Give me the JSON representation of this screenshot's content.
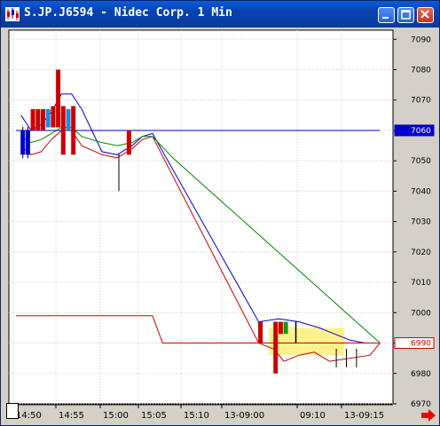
{
  "window": {
    "title": "S.JP.J6594 - Nidec Corp. 1 Min",
    "icon": "candlestick-app-icon",
    "buttons": [
      "minimize-icon",
      "maximize-icon",
      "close-icon"
    ]
  },
  "chart_data": {
    "type": "line",
    "ylim": [
      6970,
      7093
    ],
    "y_ticks": [
      "7090",
      "7080",
      "7070",
      "7060",
      "7050",
      "7040",
      "7030",
      "7020",
      "7010",
      "7000",
      "6990",
      "6980",
      "6970"
    ],
    "x_tick_labels": [
      "14:50",
      "14:55",
      "15:00",
      "15:05",
      "15:10",
      "13-09:00",
      "09:10",
      "13-09:15"
    ],
    "grid": true,
    "price_markers": [
      {
        "value": 7060,
        "label": "7060",
        "color": "#0000cc"
      },
      {
        "value": 6990,
        "label": "6990",
        "color": "#cc0000"
      }
    ],
    "bars": [
      {
        "slot": 1,
        "open": 7060,
        "close": 7052,
        "color": "#0000cc",
        "wick": true
      },
      {
        "slot": 2,
        "open": 7060,
        "close": 7052,
        "color": "#0000cc",
        "wick": true
      },
      {
        "slot": 3,
        "open": 7067,
        "close": 7060,
        "color": "#cc0000"
      },
      {
        "slot": 4,
        "open": 7067,
        "close": 7060,
        "color": "#cc0000"
      },
      {
        "slot": 5,
        "open": 7067,
        "close": 7060,
        "color": "#cc0000"
      },
      {
        "slot": 6,
        "open": 7061,
        "close": 7067,
        "color": "#2288dd"
      },
      {
        "slot": 7,
        "open": 7061,
        "close": 7068,
        "color": "#cc0000"
      },
      {
        "slot": 8,
        "open": 7080,
        "close": 7061,
        "color": "#cc0000"
      },
      {
        "slot": 9,
        "open": 7068,
        "close": 7052,
        "color": "#cc0000"
      },
      {
        "slot": 10,
        "open": 7067,
        "close": 7060,
        "color": "#2288dd"
      },
      {
        "slot": 11,
        "open": 7068,
        "close": 7052,
        "color": "#cc0000"
      },
      {
        "slot": 20,
        "open": 7052,
        "close": 7052,
        "color": "#000000",
        "low": 7040
      },
      {
        "slot": 22,
        "open": 7060,
        "close": 7052,
        "color": "#cc0000"
      },
      {
        "slot": 48,
        "open": 6997,
        "close": 6990,
        "color": "#cc0000"
      },
      {
        "slot": 51,
        "open": 6997,
        "close": 6980,
        "color": "#cc0000"
      },
      {
        "slot": 52,
        "open": 6997,
        "close": 6993,
        "color": "#cc0000"
      },
      {
        "slot": 53,
        "open": 6997,
        "close": 6993,
        "color": "#119911"
      },
      {
        "slot": 55,
        "open": 6997,
        "close": 6990,
        "color": "#000000",
        "low": 6990
      },
      {
        "slot": 63,
        "open": 6988,
        "close": 6988,
        "color": "#000000",
        "low": 6982
      },
      {
        "slot": 65,
        "open": 6988,
        "close": 6988,
        "color": "#000000",
        "low": 6982
      },
      {
        "slot": 67,
        "open": 6988,
        "close": 6988,
        "color": "#000000",
        "low": 6982
      }
    ],
    "series": [
      {
        "color": "#0000cc",
        "points": [
          [
            1,
            7065
          ],
          [
            3,
            7060
          ],
          [
            5,
            7062
          ],
          [
            7,
            7066
          ],
          [
            9,
            7072
          ],
          [
            11,
            7072
          ],
          [
            13,
            7067
          ],
          [
            17,
            7053
          ],
          [
            20,
            7052
          ],
          [
            23,
            7055
          ],
          [
            25,
            7058
          ],
          [
            27,
            7059
          ],
          [
            48,
            6997
          ],
          [
            52,
            6998
          ],
          [
            56,
            6997
          ],
          [
            60,
            6995
          ],
          [
            63,
            6993
          ],
          [
            66,
            6991
          ],
          [
            69,
            6990
          ],
          [
            72,
            6990
          ]
        ]
      },
      {
        "color": "#cc0000",
        "points": [
          [
            1,
            7055
          ],
          [
            3,
            7052
          ],
          [
            5,
            7053
          ],
          [
            7,
            7057
          ],
          [
            9,
            7060
          ],
          [
            11,
            7060
          ],
          [
            13,
            7055
          ],
          [
            17,
            7052
          ],
          [
            20,
            7051
          ],
          [
            23,
            7054
          ],
          [
            25,
            7057
          ],
          [
            27,
            7058
          ],
          [
            48,
            6990
          ],
          [
            51,
            6988
          ],
          [
            53,
            6984
          ],
          [
            56,
            6986
          ],
          [
            59,
            6987
          ],
          [
            62,
            6984
          ],
          [
            66,
            6985
          ],
          [
            70,
            6986
          ],
          [
            72,
            6990
          ]
        ]
      },
      {
        "color": "#008800",
        "points": [
          [
            1,
            7058
          ],
          [
            3,
            7056
          ],
          [
            5,
            7057
          ],
          [
            7,
            7059
          ],
          [
            9,
            7061
          ],
          [
            11,
            7061
          ],
          [
            13,
            7058
          ],
          [
            17,
            7056
          ],
          [
            20,
            7055
          ],
          [
            23,
            7056
          ],
          [
            25,
            7058
          ],
          [
            27,
            7058
          ],
          [
            31,
            7051
          ],
          [
            72,
            6990
          ]
        ]
      },
      {
        "color": "#cc0000",
        "points": [
          [
            0,
            6999
          ],
          [
            27,
            6999
          ],
          [
            29,
            6990
          ],
          [
            72,
            6990
          ]
        ]
      },
      {
        "color": "#0000cc",
        "points": [
          [
            0,
            7060
          ],
          [
            72,
            7060
          ]
        ]
      }
    ],
    "highlight": {
      "x_from": 50,
      "x_to": 65,
      "y_from": 6986,
      "y_to": 6995,
      "color": "#ffee66"
    }
  }
}
